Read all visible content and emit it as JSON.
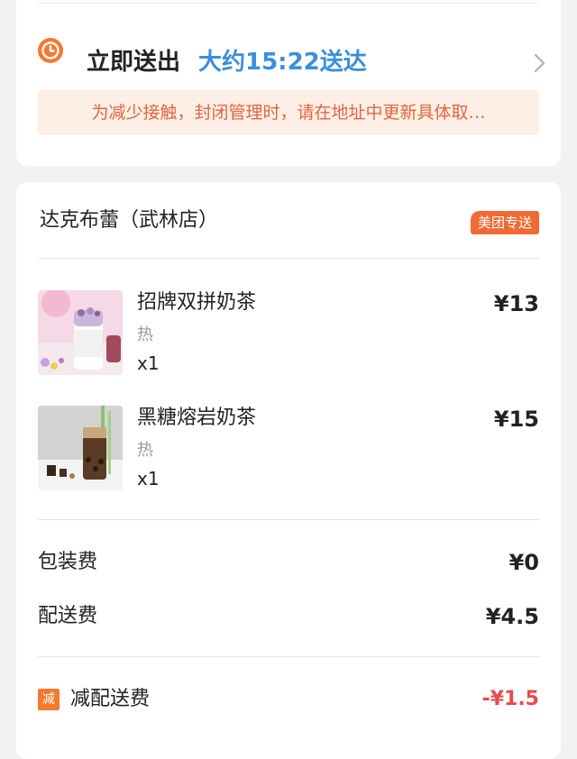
{
  "delivery": {
    "title": "立即送出",
    "eta": "大约15:22送达",
    "notice": "为减少接触，封闭管理时，请在地址中更新具体取…",
    "icon": "clock-icon",
    "accent_color": "#f5792f",
    "eta_color": "#3b8fd9"
  },
  "order": {
    "shop_name": "达克布蕾（武林店）",
    "delivery_badge": "美团专送",
    "items": [
      {
        "name": "招牌双拼奶茶",
        "spec": "热",
        "qty": "x1",
        "price": "¥13"
      },
      {
        "name": "黑糖熔岩奶茶",
        "spec": "热",
        "qty": "x1",
        "price": "¥15"
      }
    ],
    "fees": {
      "packing_label": "包装费",
      "packing_value": "¥0",
      "delivery_label": "配送费",
      "delivery_value": "¥4.5"
    },
    "discount": {
      "icon_text": "减",
      "label": "减配送费",
      "value": "-¥1.5"
    }
  }
}
